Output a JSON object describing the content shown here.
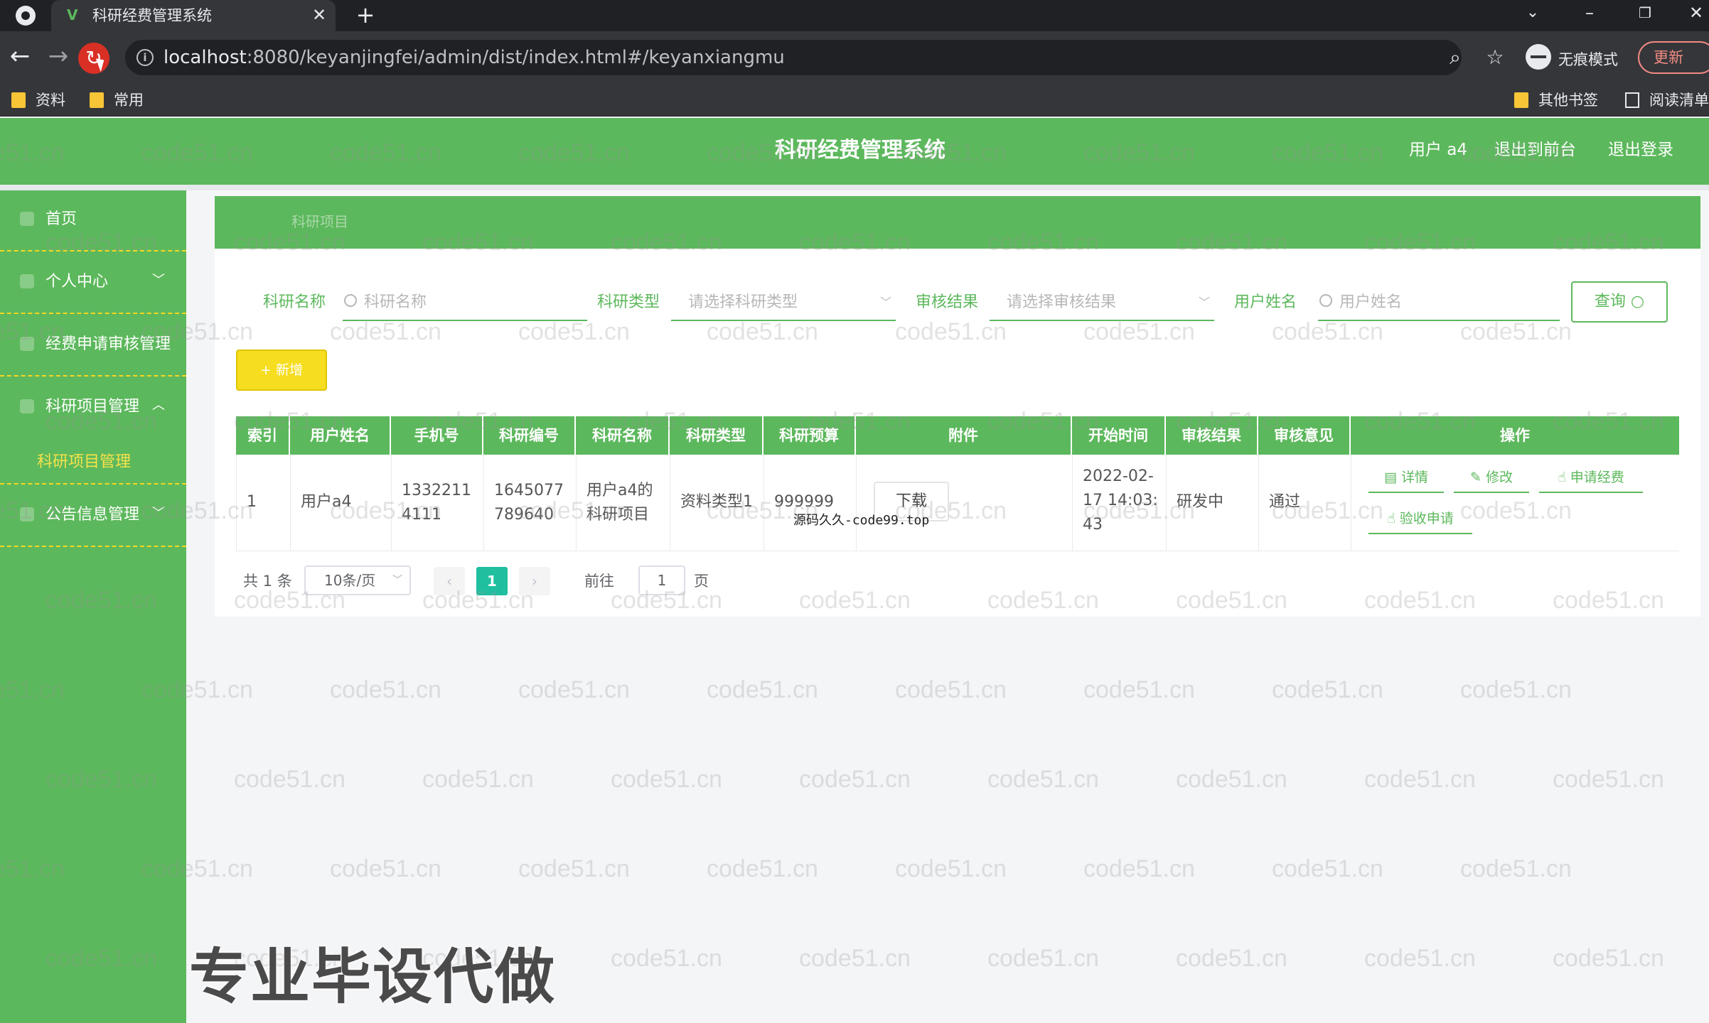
{
  "browser": {
    "tab_title": "科研经费管理系统",
    "url_host": "localhost",
    "url_rest": ":8080/keyanjingfei/admin/dist/index.html#/keyanxiangmu",
    "incognito_label": "无痕模式",
    "update_label": "更新",
    "bookmarks": [
      "资料",
      "常用",
      "其他书签",
      "阅读清单"
    ]
  },
  "header": {
    "title": "科研经费管理系统",
    "user_label": "用户 a4",
    "to_front_label": "退出到前台",
    "logout_label": "退出登录"
  },
  "sidebar": {
    "items": [
      {
        "label": "首页"
      },
      {
        "label": "个人中心"
      },
      {
        "label": "经费申请审核管理"
      },
      {
        "label": "科研项目管理"
      },
      {
        "label": "公告信息管理"
      }
    ],
    "active_sub": "科研项目管理"
  },
  "breadcrumb": "科研项目",
  "filters": {
    "name_label": "科研名称",
    "name_placeholder": "科研名称",
    "type_label": "科研类型",
    "type_placeholder": "请选择科研类型",
    "audit_label": "审核结果",
    "audit_placeholder": "请选择审核结果",
    "user_label": "用户姓名",
    "user_placeholder": "用户姓名",
    "query_label": "查询",
    "add_label": "+ 新增"
  },
  "table": {
    "headers": [
      "索引",
      "用户姓名",
      "手机号",
      "科研编号",
      "科研名称",
      "科研类型",
      "科研预算",
      "附件",
      "开始时间",
      "审核结果",
      "审核意见",
      "操作"
    ],
    "rows": [
      {
        "index": "1",
        "user": "用户a4",
        "phone_1": "1332211",
        "phone_2": "4111",
        "code_1": "1645077",
        "code_2": "789640",
        "name_1": "用户a4的",
        "name_2": "科研项目",
        "type": "资料类型1",
        "budget": "999999",
        "attachment_label": "下载",
        "start_1": "2022-02-",
        "start_2": "17 14:03:",
        "start_3": "43",
        "status": "研发中",
        "opinion": "通过",
        "actions": [
          "详情",
          "修改",
          "申请经费",
          "验收申请"
        ]
      }
    ]
  },
  "pagination": {
    "total": "共 1 条",
    "page_size": "10条/页",
    "current_page": "1",
    "goto_label": "前往",
    "goto_value": "1",
    "page_unit": "页"
  },
  "overlay": {
    "watermark": "code51.cn",
    "source_note": "源码久久-code99.top",
    "promo": "专业毕设代做"
  },
  "colors": {
    "primary": "#5cb85c",
    "accent_yellow": "#f6dd1f",
    "pager_active": "#1fbf9f"
  }
}
